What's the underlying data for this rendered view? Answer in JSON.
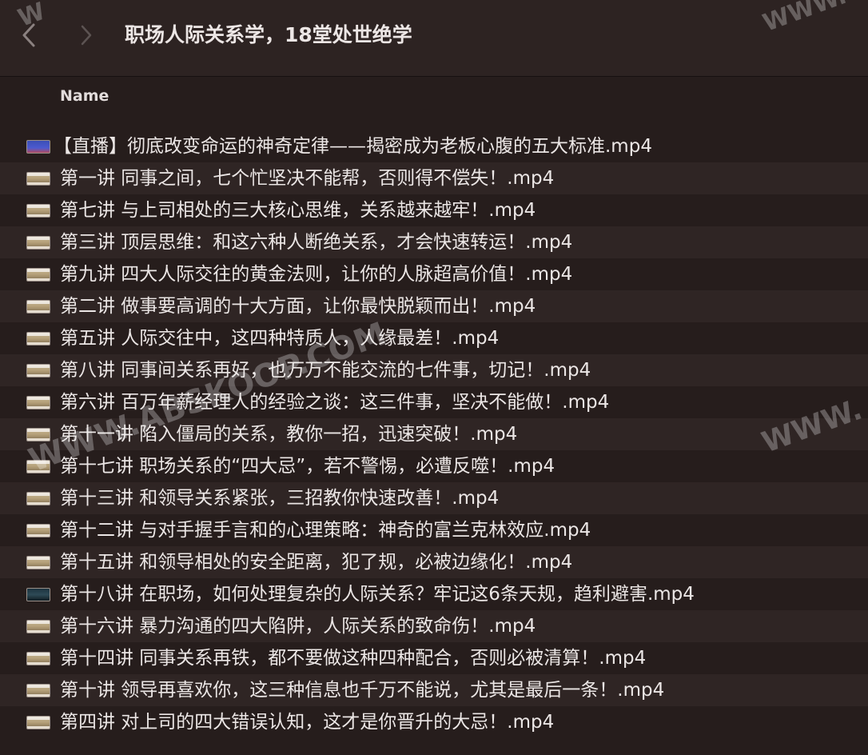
{
  "window": {
    "title": "职场人际关系学，18堂处世绝学"
  },
  "toolbar": {
    "back_icon": "chevron-left-icon",
    "forward_icon": "chevron-right-icon"
  },
  "columns": {
    "name_header": "Name"
  },
  "files": [
    {
      "name": "【直播】彻底改变命运的神奇定律——揭密成为老板心腹的五大标准.mp4",
      "thumb": "live"
    },
    {
      "name": "第一讲 同事之间，七个忙坚决不能帮，否则得不偿失！.mp4",
      "thumb": "video"
    },
    {
      "name": "第七讲 与上司相处的三大核心思维，关系越来越牢！.mp4",
      "thumb": "video"
    },
    {
      "name": "第三讲 顶层思维：和这六种人断绝关系，才会快速转运！.mp4",
      "thumb": "video"
    },
    {
      "name": "第九讲 四大人际交往的黄金法则，让你的人脉超高价值！.mp4",
      "thumb": "video"
    },
    {
      "name": "第二讲 做事要高调的十大方面，让你最快脱颖而出！.mp4",
      "thumb": "video"
    },
    {
      "name": "第五讲 人际交往中，这四种特质人，人缘最差！.mp4",
      "thumb": "video"
    },
    {
      "name": "第八讲 同事间关系再好，也万万不能交流的七件事，切记！.mp4",
      "thumb": "video"
    },
    {
      "name": "第六讲 百万年薪经理人的经验之谈：这三件事，坚决不能做！.mp4",
      "thumb": "video"
    },
    {
      "name": "第十一讲 陷入僵局的关系，教你一招，迅速突破！.mp4",
      "thumb": "video"
    },
    {
      "name": "第十七讲 职场关系的“四大忌”，若不警惕，必遭反噬！.mp4",
      "thumb": "video"
    },
    {
      "name": "第十三讲 和领导关系紧张，三招教你快速改善！.mp4",
      "thumb": "video"
    },
    {
      "name": "第十二讲 与对手握手言和的心理策略：神奇的富兰克林效应.mp4",
      "thumb": "video"
    },
    {
      "name": "第十五讲 和领导相处的安全距离，犯了规，必被边缘化！.mp4",
      "thumb": "video"
    },
    {
      "name": "第十八讲 在职场，如何处理复杂的人际关系？牢记这6条天规，趋利避害.mp4",
      "thumb": "dark"
    },
    {
      "name": "第十六讲 暴力沟通的四大陷阱，人际关系的致命伤！.mp4",
      "thumb": "video"
    },
    {
      "name": "第十四讲 同事关系再铁，都不要做这种四种配合，否则必被清算！.mp4",
      "thumb": "video"
    },
    {
      "name": "第十讲 领导再喜欢你，这三种信息也千万不能说，尤其是最后一条！.mp4",
      "thumb": "video"
    },
    {
      "name": "第四讲 对上司的四大错误认知，这才是你晋升的大忌！.mp4",
      "thumb": "video"
    }
  ],
  "watermarks": {
    "center": "WWW.ABSKOOP.COM",
    "right_middle": "WWW.",
    "top_left": "W",
    "top_right": "WWW."
  },
  "colors": {
    "background": "#261d1c",
    "row_alt": "#2f2524",
    "toolbar": "#2d2322",
    "text": "#ebe6e5"
  }
}
